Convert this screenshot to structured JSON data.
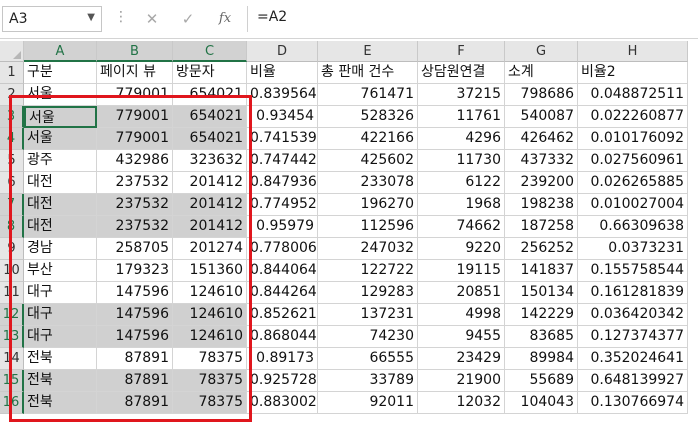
{
  "formula_bar": {
    "name_box": "A3",
    "cancel_icon": "✕",
    "enter_icon": "✓",
    "fx_label": "fx",
    "formula": "=A2"
  },
  "columns": [
    "A",
    "B",
    "C",
    "D",
    "E",
    "F",
    "G",
    "H"
  ],
  "header_row": [
    "구분",
    "페이지 뷰",
    "방문자",
    "비율",
    "총 판매 건수",
    "상담원연결",
    "소계",
    "비율2"
  ],
  "rows": [
    {
      "n": "2",
      "hl": false,
      "cells": [
        "서울",
        "779001",
        "654021",
        "0.839564",
        "761471",
        "37215",
        "798686",
        "0.048872511"
      ]
    },
    {
      "n": "3",
      "hl": true,
      "cells": [
        "서울",
        "779001",
        "654021",
        "0.93454",
        "528326",
        "11761",
        "540087",
        "0.022260877"
      ]
    },
    {
      "n": "4",
      "hl": true,
      "cells": [
        "서울",
        "779001",
        "654021",
        "0.741539",
        "422166",
        "4296",
        "426462",
        "0.010176092"
      ]
    },
    {
      "n": "5",
      "hl": false,
      "cells": [
        "광주",
        "432986",
        "323632",
        "0.747442",
        "425602",
        "11730",
        "437332",
        "0.027560961"
      ]
    },
    {
      "n": "6",
      "hl": false,
      "cells": [
        "대전",
        "237532",
        "201412",
        "0.847936",
        "233078",
        "6122",
        "239200",
        "0.026265885"
      ]
    },
    {
      "n": "7",
      "hl": true,
      "cells": [
        "대전",
        "237532",
        "201412",
        "0.774952",
        "196270",
        "1968",
        "198238",
        "0.010027004"
      ]
    },
    {
      "n": "8",
      "hl": true,
      "cells": [
        "대전",
        "237532",
        "201412",
        "0.95979",
        "112596",
        "74662",
        "187258",
        "0.66309638"
      ]
    },
    {
      "n": "9",
      "hl": false,
      "cells": [
        "경남",
        "258705",
        "201274",
        "0.778006",
        "247032",
        "9220",
        "256252",
        "0.0373231"
      ]
    },
    {
      "n": "10",
      "hl": false,
      "cells": [
        "부산",
        "179323",
        "151360",
        "0.844064",
        "122722",
        "19115",
        "141837",
        "0.155758544"
      ]
    },
    {
      "n": "11",
      "hl": false,
      "cells": [
        "대구",
        "147596",
        "124610",
        "0.844264",
        "129283",
        "20851",
        "150134",
        "0.161281839"
      ]
    },
    {
      "n": "12",
      "hl": true,
      "cells": [
        "대구",
        "147596",
        "124610",
        "0.852621",
        "137231",
        "4998",
        "142229",
        "0.036420342"
      ]
    },
    {
      "n": "13",
      "hl": true,
      "cells": [
        "대구",
        "147596",
        "124610",
        "0.868044",
        "74230",
        "9455",
        "83685",
        "0.127374377"
      ]
    },
    {
      "n": "14",
      "hl": false,
      "cells": [
        "전북",
        "87891",
        "78375",
        "0.89173",
        "66555",
        "23429",
        "89984",
        "0.352024641"
      ]
    },
    {
      "n": "15",
      "hl": true,
      "cells": [
        "전북",
        "87891",
        "78375",
        "0.925728",
        "33789",
        "21900",
        "55689",
        "0.648139927"
      ]
    },
    {
      "n": "16",
      "hl": true,
      "cells": [
        "전북",
        "87891",
        "78375",
        "0.883002",
        "92011",
        "12032",
        "104043",
        "0.130766974"
      ]
    }
  ],
  "colors": {
    "selection_green": "#217346",
    "highlight_gray": "#d0d0d0",
    "annotation_red": "#e0161d"
  }
}
